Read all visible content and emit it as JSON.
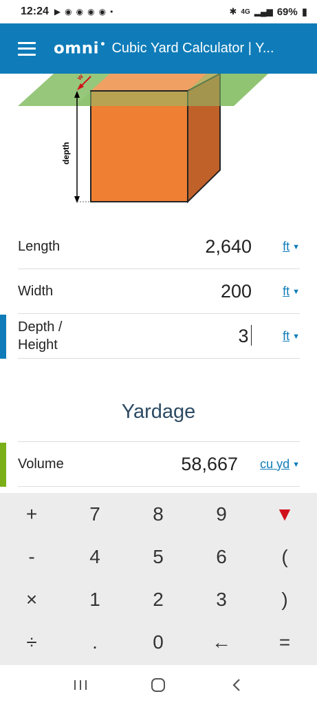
{
  "status_bar": {
    "time": "12:24",
    "network": "4G",
    "battery": "69%"
  },
  "app_bar": {
    "logo": "omni",
    "title": "Cubic Yard Calculator | Y..."
  },
  "illustration": {
    "depth_label": "depth",
    "width_label": "w"
  },
  "fields": [
    {
      "label": "Length",
      "value": "2,640",
      "unit": "ft"
    },
    {
      "label": "Width",
      "value": "200",
      "unit": "ft"
    },
    {
      "label": "Depth / Height",
      "value": "3",
      "unit": "ft"
    }
  ],
  "section": {
    "title": "Yardage"
  },
  "result": {
    "label": "Volume",
    "value": "58,667",
    "unit": "cu yd"
  },
  "keypad": {
    "keys": [
      "+",
      "7",
      "8",
      "9",
      "▼",
      "-",
      "4",
      "5",
      "6",
      "(",
      "×",
      "1",
      "2",
      "3",
      ")",
      "÷",
      ".",
      "0",
      "←",
      "="
    ]
  },
  "colors": {
    "brand": "#0f7cb9",
    "result_accent": "#7aaf18",
    "cube_orange": "#ee7f33",
    "cube_side": "#c0612a",
    "ground_green": "#8cc16b",
    "keypad_bg": "#ececec",
    "keypad_down": "#d0111b"
  },
  "icons": {
    "menu": "hamburger-icon",
    "dropdown": "triangle-down-icon",
    "nav_recents": "recents-icon",
    "nav_home": "home-icon",
    "nav_back": "back-icon"
  }
}
